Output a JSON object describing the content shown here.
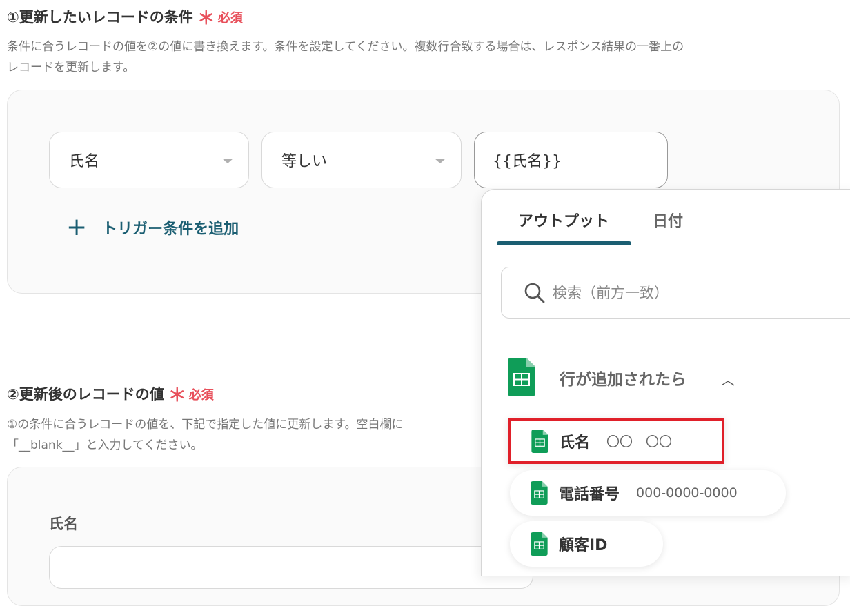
{
  "section1": {
    "title": "①更新したいレコードの条件",
    "required_star": "＊",
    "required_label": "必須",
    "description_line1": "条件に合うレコードの値を②の値に書き換えます。条件を設定してください。複数行合致する場合は、レスポンス結果の一番上の",
    "description_line2": "レコードを更新します。",
    "condition": {
      "field": "氏名",
      "operator": "等しい",
      "value": "{{氏名}}"
    },
    "add_condition_icon": "plus-icon",
    "add_condition_label": "トリガー条件を追加"
  },
  "section2": {
    "title": "②更新後のレコードの値",
    "required_star": "＊",
    "required_label": "必須",
    "description_line1": "①の条件に合うレコードの値を、下記で指定した値に更新します。空白欄に",
    "description_line2": "「__blank__」と入力してください。",
    "field_label": "氏名"
  },
  "picker": {
    "tabs": [
      {
        "label": "アウトプット",
        "active": true
      },
      {
        "label": "日付",
        "active": false
      }
    ],
    "search_placeholder": "検索（前方一致）",
    "search_icon": "search-icon",
    "group": {
      "icon": "google-sheets-icon",
      "title": "行が追加されたら",
      "chevron_icon": "chevron-up-icon",
      "chevron": "︿"
    },
    "items": [
      {
        "name": "氏名",
        "value": "〇〇　〇〇",
        "highlighted": true
      },
      {
        "name": "電話番号",
        "value": "000-0000-0000",
        "highlighted": false
      },
      {
        "name": "顧客ID",
        "value": "",
        "highlighted": false
      }
    ]
  },
  "colors": {
    "accent": "#1b5e72",
    "required": "#e8505b",
    "highlight": "#e0202a",
    "sheets_green": "#0f9d58"
  }
}
